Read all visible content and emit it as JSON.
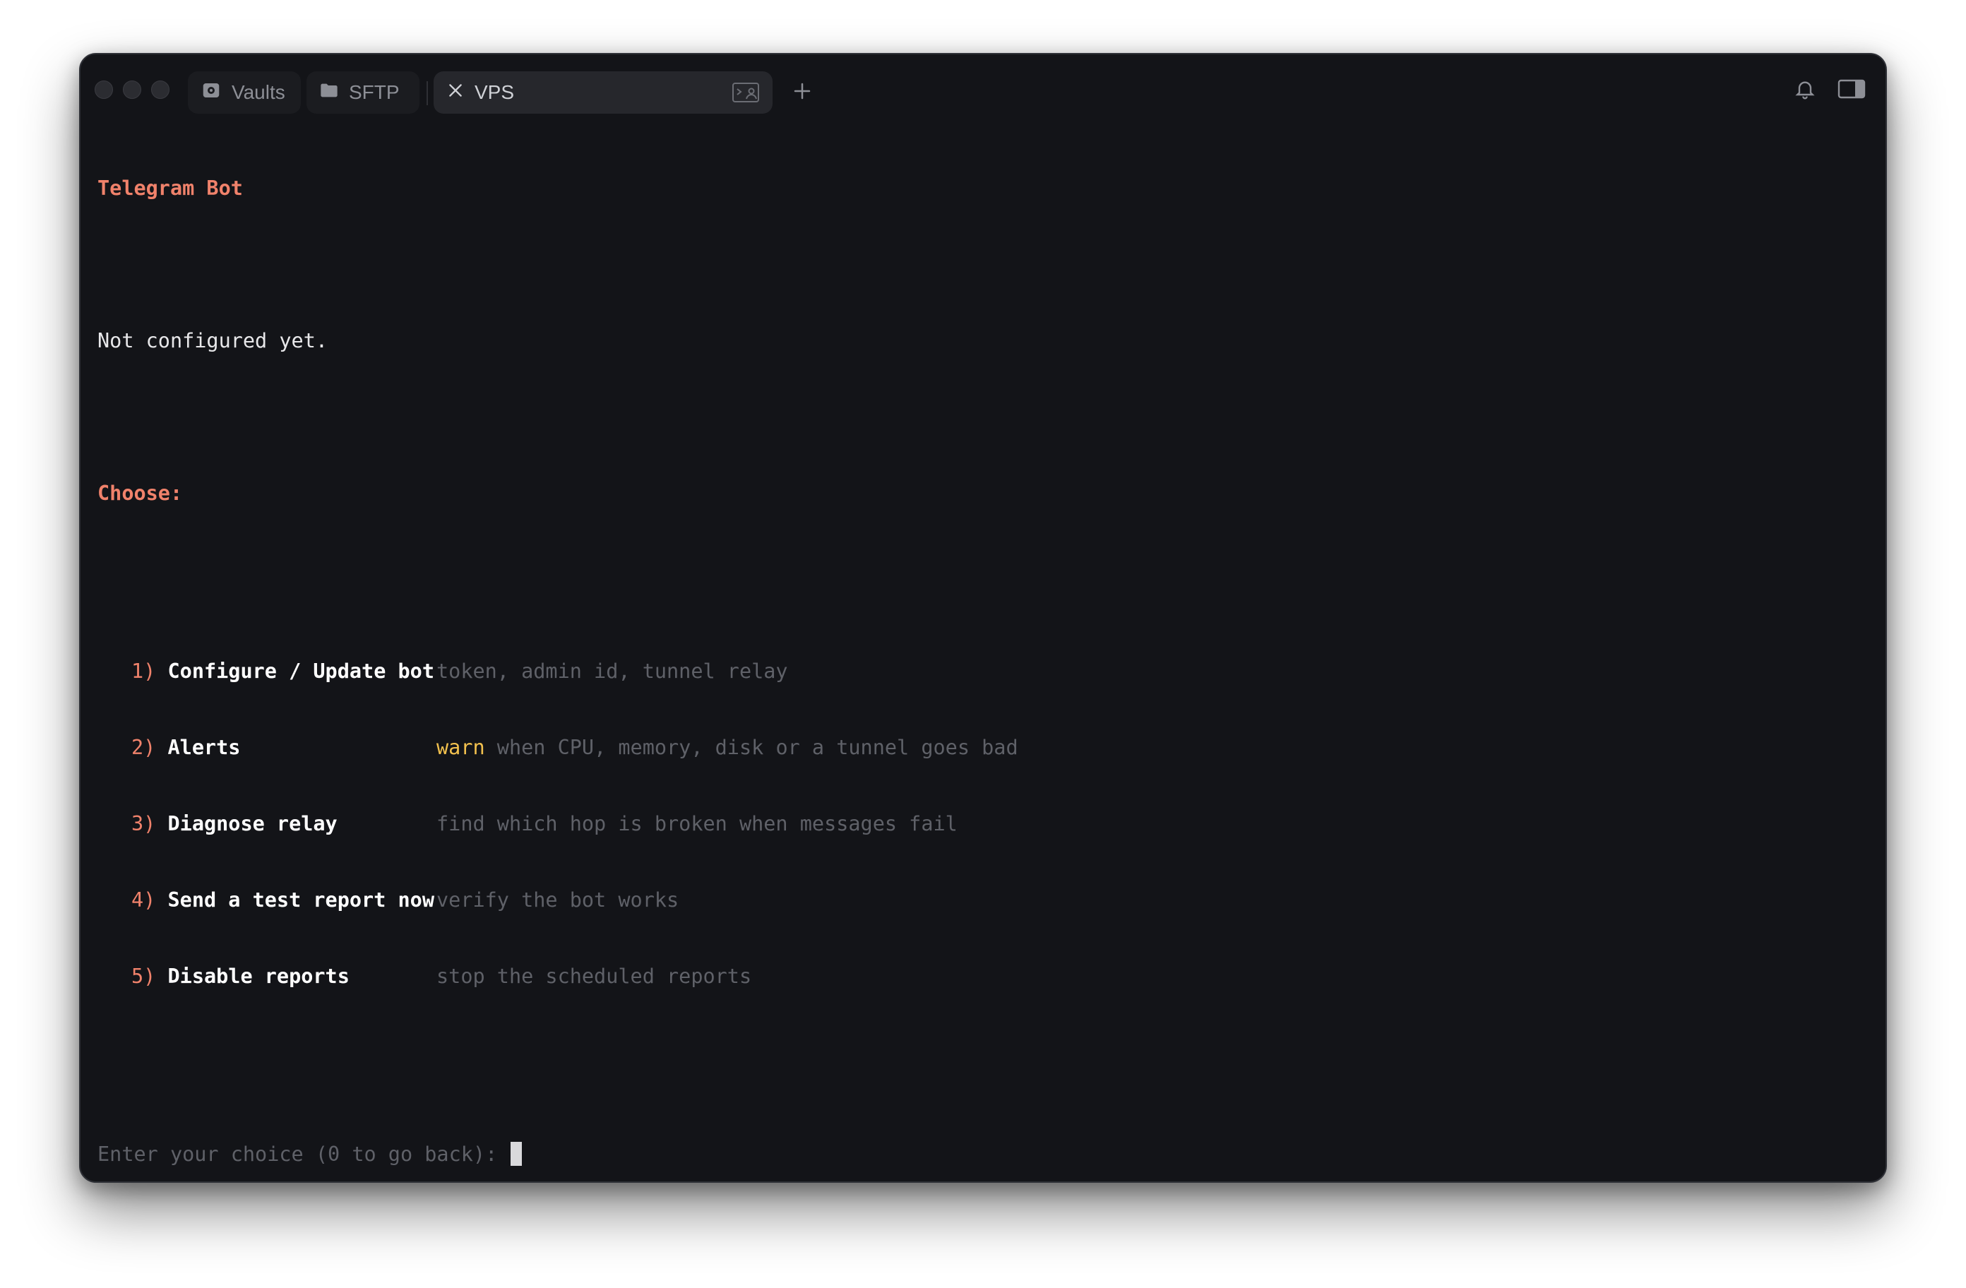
{
  "window": {
    "tabs": [
      {
        "label": "Vaults",
        "icon": "vault-icon"
      },
      {
        "label": "SFTP",
        "icon": "folder-icon"
      },
      {
        "label": "VPS",
        "icon": "close-icon",
        "active": true
      }
    ]
  },
  "terminal": {
    "title": "Telegram Bot",
    "status": "Not configured yet.",
    "choose_label": "Choose:",
    "options": [
      {
        "number": "1)",
        "label": "Configure / Update bot",
        "desc_highlight": "",
        "desc": "token, admin id, tunnel relay"
      },
      {
        "number": "2)",
        "label": "Alerts",
        "desc_highlight": "warn",
        "desc": " when CPU, memory, disk or a tunnel goes bad"
      },
      {
        "number": "3)",
        "label": "Diagnose relay",
        "desc_highlight": "",
        "desc": "find which hop is broken when messages fail"
      },
      {
        "number": "4)",
        "label": "Send a test report now",
        "desc_highlight": "",
        "desc": "verify the bot works"
      },
      {
        "number": "5)",
        "label": "Disable reports",
        "desc_highlight": "",
        "desc": "stop the scheduled reports"
      }
    ],
    "prompt": "Enter your choice (0 to go back): "
  },
  "colors": {
    "background": "#131418",
    "accent": "#f0826b",
    "warn": "#f2c14e",
    "muted": "#5f6168"
  }
}
